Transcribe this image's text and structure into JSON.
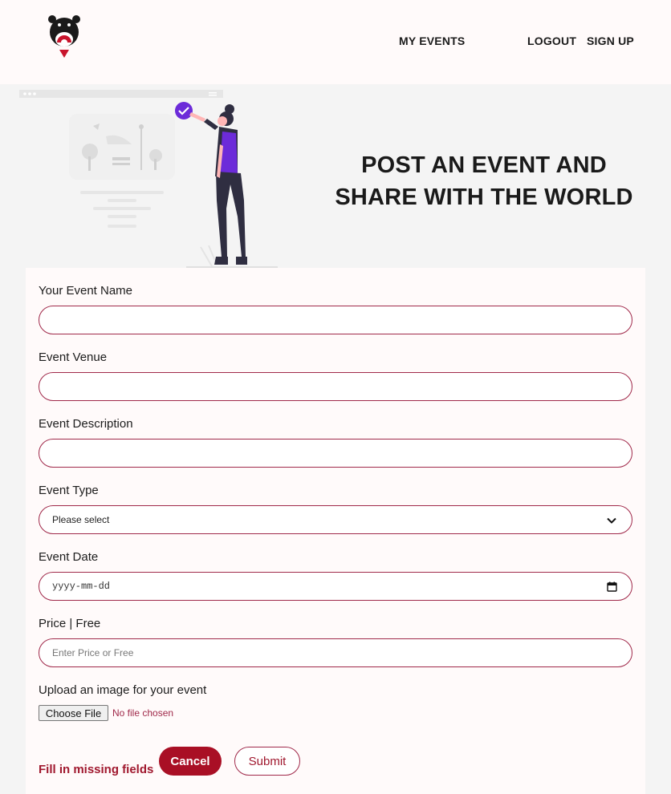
{
  "nav": {
    "my_events": "MY EVENTS",
    "logout": "LOGOUT",
    "signup": "SIGN UP"
  },
  "hero": {
    "line1": "POST AN EVENT AND",
    "line2": "SHARE WITH THE WORLD"
  },
  "form": {
    "event_name_label": "Your Event Name",
    "event_name_value": "",
    "venue_label": "Event Venue",
    "venue_value": "",
    "description_label": "Event Description",
    "description_value": "",
    "type_label": "Event Type",
    "type_selected": "Please select",
    "date_label": "Event Date",
    "date_placeholder": "yyyy-mm-dd",
    "price_label": "Price | Free",
    "price_placeholder": "Enter Price or Free",
    "upload_label": "Upload an image for your event",
    "choose_file": "Choose File",
    "no_file": "No file chosen"
  },
  "actions": {
    "error_message": "Fill in missing fields",
    "cancel": "Cancel",
    "submit": "Submit"
  },
  "colors": {
    "accent": "#a0294a",
    "button_primary": "#a90f25",
    "purple": "#6c2bd9"
  },
  "icons": [
    "bear-logo-icon",
    "chevron-down-icon",
    "calendar-icon",
    "checkmark-icon"
  ]
}
